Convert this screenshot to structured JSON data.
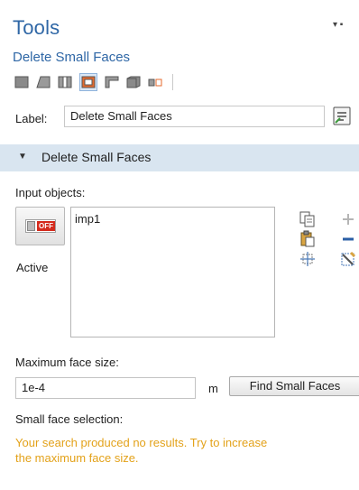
{
  "panel": {
    "title": "Tools",
    "subtitle": "Delete Small Faces",
    "toolbar_icons": [
      "vertex-icon",
      "edge-icon",
      "face-split-icon",
      "face-select-icon",
      "domain-partial-icon",
      "domain-icon",
      "pair-icon"
    ]
  },
  "label_row": {
    "label": "Label:",
    "value": "Delete Small Faces"
  },
  "section": {
    "title": "Delete Small Faces"
  },
  "input_objects": {
    "label": "Input objects:",
    "toggle_badge": "OFF",
    "active_label": "Active",
    "items": [
      "imp1"
    ]
  },
  "max_face": {
    "label": "Maximum face size:",
    "value": "1e-4",
    "unit": "m",
    "find_button": "Find Small Faces"
  },
  "selection": {
    "label": "Small face selection:",
    "message": "Your search produced no results. Try to increase the maximum face size."
  },
  "colors": {
    "accent": "#2f67a6",
    "warning": "#e3a21a",
    "section_bg": "#d9e5f0"
  }
}
